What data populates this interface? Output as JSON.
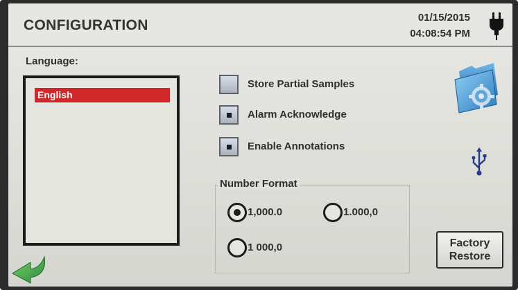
{
  "header": {
    "title": "CONFIGURATION",
    "date": "01/15/2015",
    "time": "04:08:54 PM",
    "power_icon": "plug-icon"
  },
  "language": {
    "label": "Language:",
    "items": [
      "English"
    ],
    "selected_index": 0,
    "selected_color": "#d0282a"
  },
  "options": [
    {
      "label": "Store Partial Samples",
      "checked": false
    },
    {
      "label": "Alarm Acknowledge",
      "checked": true
    },
    {
      "label": "Enable Annotations",
      "checked": true
    }
  ],
  "number_format": {
    "label": "Number Format",
    "options": [
      "1,000.0",
      "1.000,0",
      "1 000,0"
    ],
    "selected": "1,000.0"
  },
  "icons": {
    "settings": "folder-gear-icon",
    "usb": "usb-icon",
    "back": "back-arrow-icon"
  },
  "factory_restore": {
    "line1": "Factory",
    "line2": "Restore"
  }
}
